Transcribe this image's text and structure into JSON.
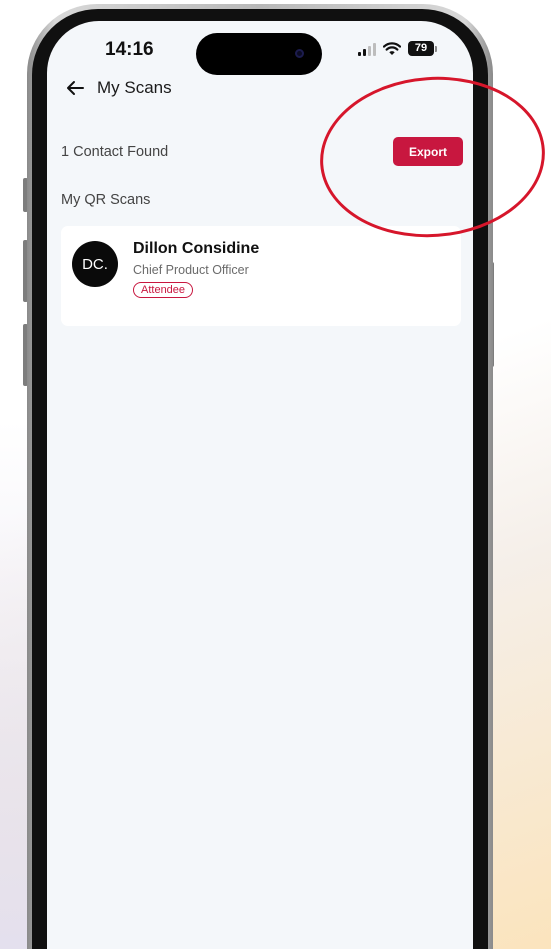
{
  "status_bar": {
    "time": "14:16",
    "battery": "79"
  },
  "header": {
    "title": "My Scans"
  },
  "summary": {
    "count_text": "1 Contact Found",
    "export_label": "Export"
  },
  "section": {
    "title": "My QR Scans"
  },
  "contacts": [
    {
      "initials": "DC.",
      "name": "Dillon Considine",
      "role": "Chief Product Officer",
      "badge": "Attendee"
    }
  ],
  "colors": {
    "accent": "#c8173f",
    "annotation": "#d6162b",
    "screen_bg": "#f4f7fa"
  },
  "icons": [
    "back-arrow-icon",
    "signal-icon",
    "wifi-icon",
    "battery-icon",
    "camera-icon"
  ]
}
